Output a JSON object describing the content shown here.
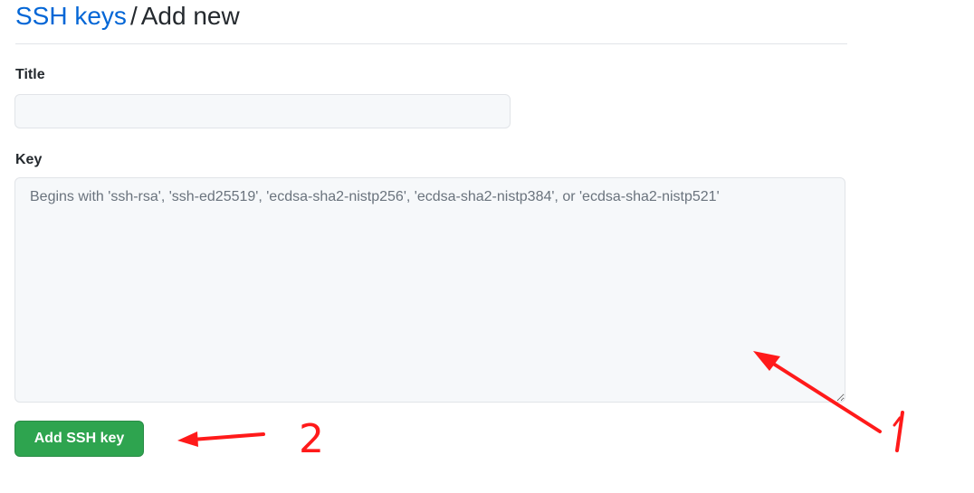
{
  "breadcrumb": {
    "parent": "SSH keys",
    "separator": "/",
    "current": "Add new"
  },
  "form": {
    "title_label": "Title",
    "title_value": "",
    "key_label": "Key",
    "key_value": "",
    "key_placeholder": "Begins with 'ssh-rsa', 'ssh-ed25519', 'ecdsa-sha2-nistp256', 'ecdsa-sha2-nistp384', or 'ecdsa-sha2-nistp521'",
    "submit_label": "Add SSH key"
  },
  "annotations": {
    "marker_1": "1",
    "marker_2": "2",
    "color": "#ff1a1a"
  },
  "colors": {
    "link": "#0366d6",
    "primary_button": "#2ea44f",
    "input_bg": "#f6f8fa",
    "border": "#e1e4e8"
  }
}
